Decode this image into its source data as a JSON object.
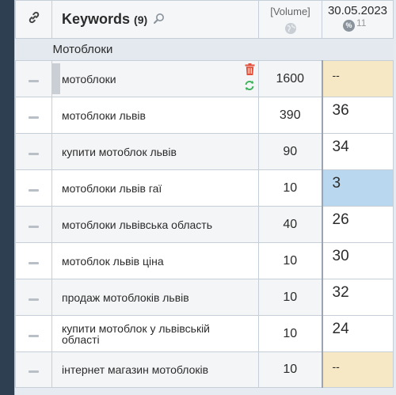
{
  "header": {
    "keywords_label": "Keywords",
    "keywords_count": "(9)",
    "volume_label": "[Volume]",
    "date_label": "30.05.2023",
    "percent_symbol": "%",
    "percent_count": "11"
  },
  "group": {
    "name": "Мотоблоки"
  },
  "rows": [
    {
      "keyword": "мотоблоки",
      "volume": "1600",
      "position": "--"
    },
    {
      "keyword": "мотоблоки львів",
      "volume": "390",
      "position": "36"
    },
    {
      "keyword": "купити мотоблок львів",
      "volume": "90",
      "position": "34"
    },
    {
      "keyword": "мотоблоки львів гаї",
      "volume": "10",
      "position": "3"
    },
    {
      "keyword": "мотоблоки львівська область",
      "volume": "40",
      "position": "26"
    },
    {
      "keyword": "мотоблок львів ціна",
      "volume": "10",
      "position": "30"
    },
    {
      "keyword": "продаж мотоблоків львів",
      "volume": "10",
      "position": "32"
    },
    {
      "keyword": "купити мотоблок у львівській області",
      "volume": "10",
      "position": "24"
    },
    {
      "keyword": "інтернет магазин мотоблоків",
      "volume": "10",
      "position": "--"
    }
  ],
  "colors": {
    "no_position": "#f6e8c4",
    "top_position": "#b9d8ef",
    "trash_icon": "#e0503c",
    "refresh_icon": "#3cb35a",
    "sidebar": "#2f3f52"
  },
  "icons": {
    "link": "link-icon",
    "search": "search-icon",
    "globe": "globe-icon",
    "trash": "trash-icon",
    "refresh": "refresh-icon",
    "row_handle": "dash-icon"
  }
}
